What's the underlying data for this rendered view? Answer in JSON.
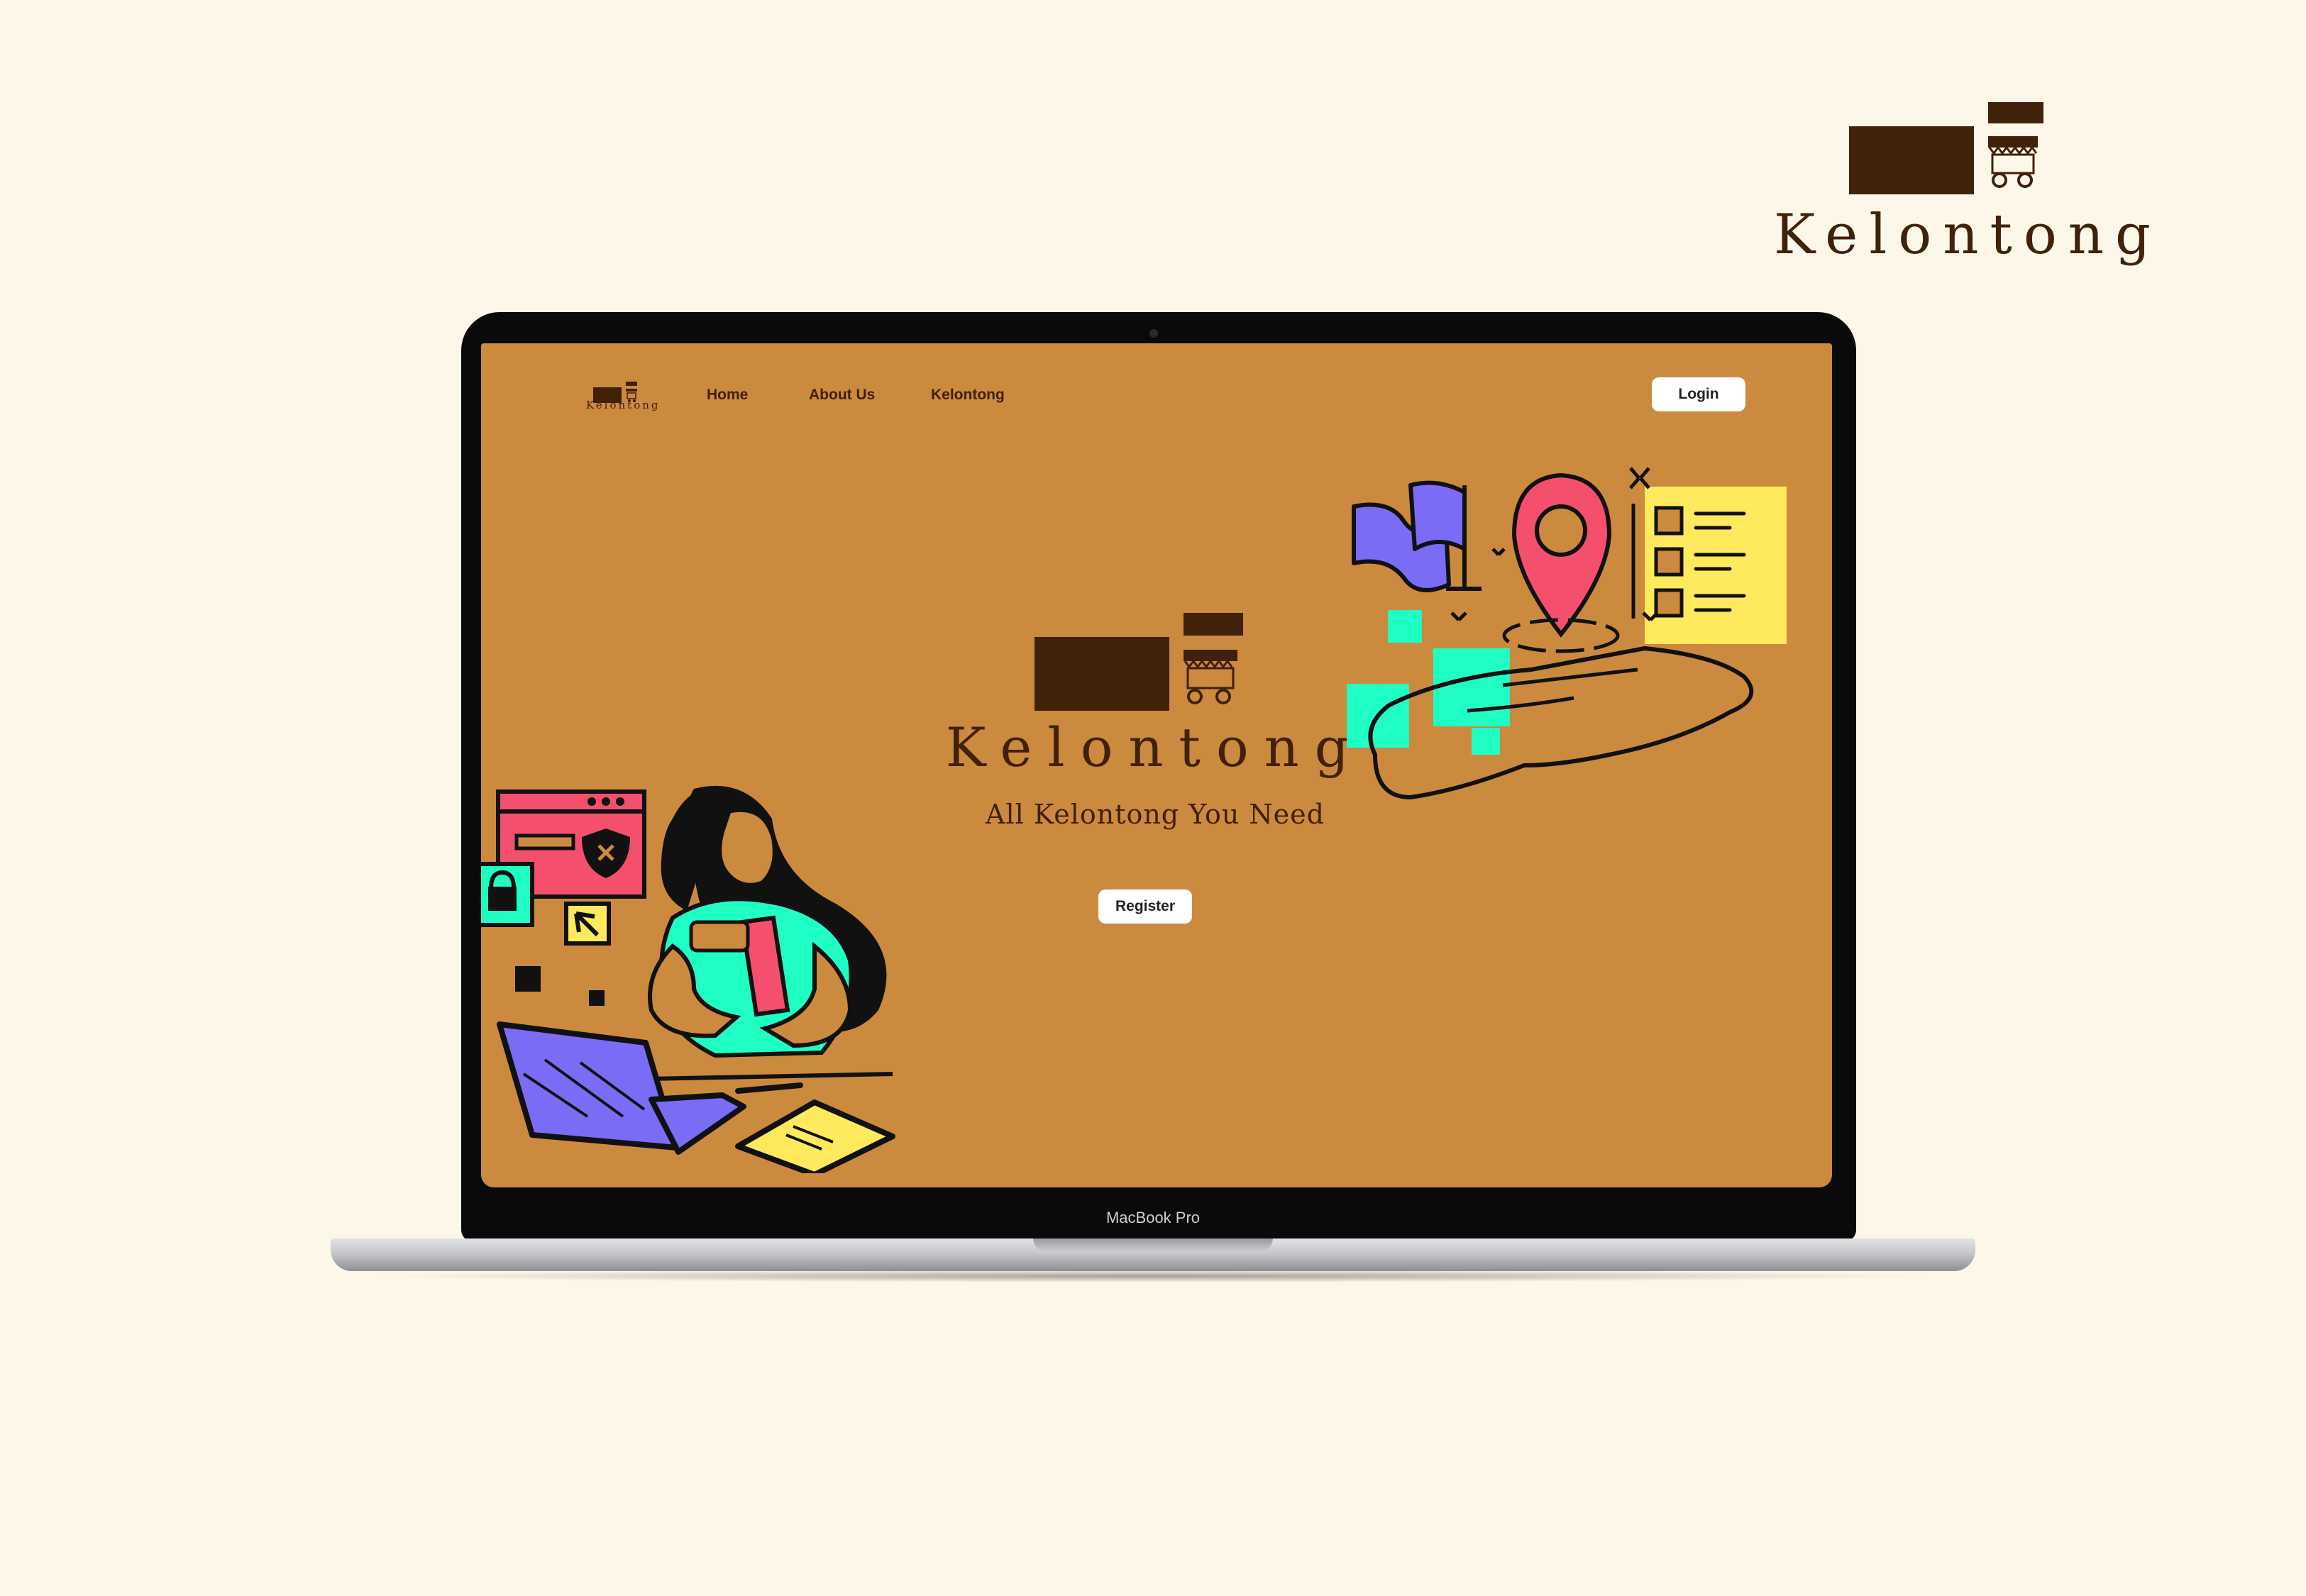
{
  "brand": {
    "name": "Kelontong"
  },
  "laptop": {
    "model_label": "MacBook Pro"
  },
  "site": {
    "nav": {
      "logo_text": "Kelontong",
      "links": [
        "Home",
        "About Us",
        "Kelontong"
      ],
      "login_label": "Login"
    },
    "hero": {
      "title": "Kelontong",
      "tagline": "All Kelontong You Need",
      "register_label": "Register"
    }
  },
  "colors": {
    "page_background": "#fdf7ea",
    "brand_brown": "#40210a",
    "screen_background": "#cc8a3f",
    "accent_pink": "#f4506e",
    "accent_teal": "#1fffc4",
    "accent_purple": "#7b6cf6",
    "accent_yellow": "#ffe95c"
  },
  "icons": [
    "store-cart-icon",
    "location-pin-icon",
    "flag-icon",
    "checklist-icon",
    "open-hand-icon",
    "security-shield-icon",
    "padlock-icon",
    "cursor-arrow-icon",
    "laptop-icon",
    "notepad-icon"
  ]
}
